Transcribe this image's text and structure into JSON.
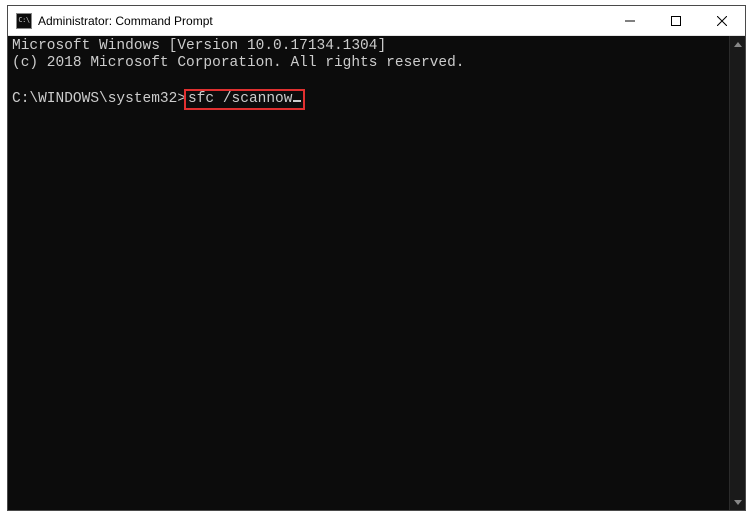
{
  "window": {
    "title": "Administrator: Command Prompt"
  },
  "console": {
    "line1": "Microsoft Windows [Version 10.0.17134.1304]",
    "line2": "(c) 2018 Microsoft Corporation. All rights reserved.",
    "prompt": "C:\\WINDOWS\\system32>",
    "command": "sfc /scannow"
  }
}
